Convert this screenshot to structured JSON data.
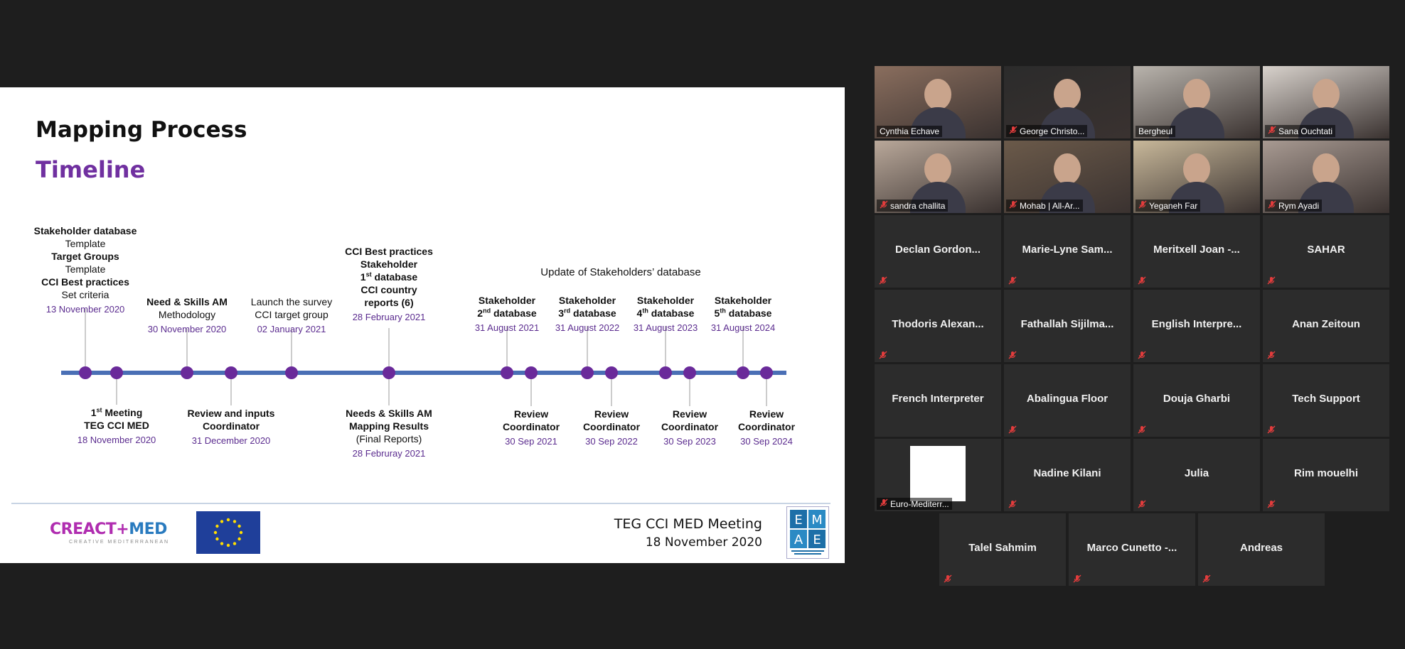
{
  "slide": {
    "title": "Mapping Process",
    "subtitle": "Timeline",
    "update_note": "Update of Stakeholders’ database",
    "top": [
      {
        "lines": [
          {
            "t": "Stakeholder database",
            "w": "b"
          },
          {
            "t": "Template"
          },
          {
            "t": "Target Groups",
            "w": "b"
          },
          {
            "t": "Template"
          },
          {
            "t": "CCI Best practices",
            "w": "b"
          },
          {
            "t": "Set criteria"
          }
        ],
        "date": "13 November 2020"
      },
      {
        "lines": [
          {
            "t": "Need & Skills AM",
            "w": "b"
          },
          {
            "t": "Methodology"
          }
        ],
        "date": "30 November 2020"
      },
      {
        "lines": [
          {
            "t": "Launch the survey"
          },
          {
            "t": "CCI target group"
          }
        ],
        "date": "02 January 2021"
      },
      {
        "lines": [
          {
            "t": "CCI Best practices",
            "w": "b"
          },
          {
            "t": "Stakeholder",
            "w": "b"
          },
          {
            "t": "1st database",
            "w": "b"
          },
          {
            "t": " "
          },
          {
            "t": "CCI country",
            "w": "b"
          },
          {
            "t": "reports (6)",
            "w": "b"
          }
        ],
        "date": "28 February 2021"
      },
      {
        "lines": [
          {
            "t": "Stakeholder",
            "w": "b"
          },
          {
            "t": "2nd database",
            "w": "b"
          }
        ],
        "date": "31 August 2021"
      },
      {
        "lines": [
          {
            "t": "Stakeholder",
            "w": "b"
          },
          {
            "t": "3rd database",
            "w": "b"
          }
        ],
        "date": "31 August 2022"
      },
      {
        "lines": [
          {
            "t": "Stakeholder",
            "w": "b"
          },
          {
            "t": "4th database",
            "w": "b"
          }
        ],
        "date": "31 August 2023"
      },
      {
        "lines": [
          {
            "t": "Stakeholder",
            "w": "b"
          },
          {
            "t": "5th database",
            "w": "b"
          }
        ],
        "date": "31 August 2024"
      }
    ],
    "bottom": [
      {
        "lines": [
          {
            "t": "1st Meeting",
            "w": "b"
          },
          {
            "t": "TEG CCI MED",
            "w": "b"
          }
        ],
        "date": "18 November 2020"
      },
      {
        "lines": [
          {
            "t": "Review and inputs",
            "w": "b"
          },
          {
            "t": "Coordinator",
            "w": "b"
          }
        ],
        "date": "31 December 2020"
      },
      {
        "lines": [
          {
            "t": "Needs & Skills AM",
            "w": "b"
          },
          {
            "t": "Mapping Results",
            "w": "b"
          },
          {
            "t": "(Final Reports)"
          }
        ],
        "date": "28 Februray 2021"
      },
      {
        "lines": [
          {
            "t": "Review",
            "w": "b"
          },
          {
            "t": "Coordinator",
            "w": "b"
          }
        ],
        "date": "30 Sep 2021"
      },
      {
        "lines": [
          {
            "t": "Review",
            "w": "b"
          },
          {
            "t": "Coordinator",
            "w": "b"
          }
        ],
        "date": "30 Sep 2022"
      },
      {
        "lines": [
          {
            "t": "Review",
            "w": "b"
          },
          {
            "t": "Coordinator",
            "w": "b"
          }
        ],
        "date": "30 Sep 2023"
      },
      {
        "lines": [
          {
            "t": "Review",
            "w": "b"
          },
          {
            "t": "Coordinator",
            "w": "b"
          }
        ],
        "date": "30 Sep 2024"
      }
    ],
    "footer": {
      "meeting": "TEG CCI MED Meeting",
      "date": "18 November 2020"
    },
    "logo": {
      "creact": "CREACT",
      "med": "MED",
      "tag": "CREATIVE MEDITERRANEAN"
    },
    "colors": {
      "dot": "#6a2a9a",
      "line": "#4a6fb5",
      "date": "#5b2c8f",
      "subtitle": "#7030a0"
    }
  },
  "participants": [
    {
      "name": "Cynthia Echave",
      "video": true,
      "muted": false,
      "active": true,
      "bg": "#8a6e5e"
    },
    {
      "name": "George Christo...",
      "video": true,
      "muted": true,
      "bg": "#2b2b2b"
    },
    {
      "name": "Bergheul",
      "video": true,
      "muted": false,
      "bg": "#b9b4ad"
    },
    {
      "name": "Sana Ouchtati",
      "video": true,
      "muted": true,
      "bg": "#d8d2cc"
    },
    {
      "name": "sandra challita",
      "video": true,
      "muted": true,
      "bg": "#b9a89a"
    },
    {
      "name": "Mohab | All-Ar...",
      "video": true,
      "muted": true,
      "bg": "#6b5a4a"
    },
    {
      "name": "Yeganeh Far",
      "video": true,
      "muted": true,
      "bg": "#c8b89a"
    },
    {
      "name": "Rym Ayadi",
      "video": true,
      "muted": true,
      "bg": "#a89a92"
    },
    {
      "name": "Declan Gordon...",
      "video": false,
      "muted": true
    },
    {
      "name": "Marie-Lyne Sam...",
      "video": false,
      "muted": true
    },
    {
      "name": "Meritxell Joan -...",
      "video": false,
      "muted": true
    },
    {
      "name": "SAHAR",
      "video": false,
      "muted": true
    },
    {
      "name": "Thodoris Alexan...",
      "video": false,
      "muted": true
    },
    {
      "name": "Fathallah Sijilma...",
      "video": false,
      "muted": true
    },
    {
      "name": "English Interpre...",
      "video": false,
      "muted": true
    },
    {
      "name": "Anan Zeitoun",
      "video": false,
      "muted": true
    },
    {
      "name": "French Interpreter",
      "video": false,
      "muted": false
    },
    {
      "name": "Abalingua Floor",
      "video": false,
      "muted": true
    },
    {
      "name": "Douja Gharbi",
      "video": false,
      "muted": true
    },
    {
      "name": "Tech Support",
      "video": false,
      "muted": true
    },
    {
      "name": "Euro-Mediterr...",
      "video": true,
      "logo": true,
      "muted": true,
      "bg": "#2c2c2c"
    },
    {
      "name": "Nadine Kilani",
      "video": false,
      "muted": true
    },
    {
      "name": "Julia",
      "video": false,
      "muted": true
    },
    {
      "name": "Rim mouelhi",
      "video": false,
      "muted": true
    },
    {
      "name": "Talel Sahmim",
      "video": false,
      "muted": true
    },
    {
      "name": "Marco Cunetto -...",
      "video": false,
      "muted": true
    },
    {
      "name": "Andreas",
      "video": false,
      "muted": true
    }
  ]
}
